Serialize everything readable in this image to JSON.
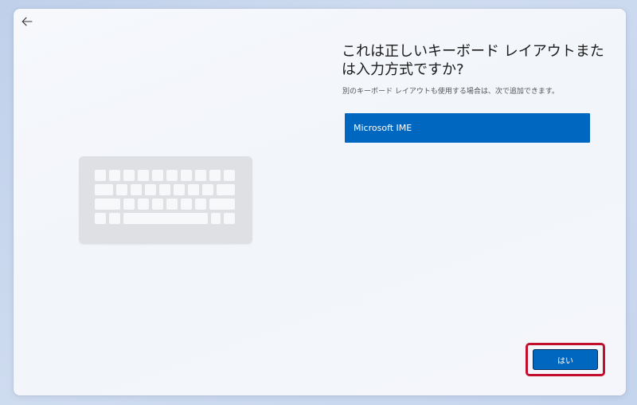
{
  "header": {
    "back_icon": "arrow-left-icon"
  },
  "illustration": {
    "icon": "keyboard-icon"
  },
  "main": {
    "title": "これは正しいキーボード レイアウトまたは入力方式ですか?",
    "subtitle": "別のキーボード レイアウトも使用する場合は、次で追加できます。",
    "options": [
      {
        "label": "Microsoft IME",
        "selected": true
      }
    ]
  },
  "footer": {
    "yes_label": "はい"
  },
  "colors": {
    "accent": "#0067c0",
    "highlight": "#c30f2e"
  }
}
